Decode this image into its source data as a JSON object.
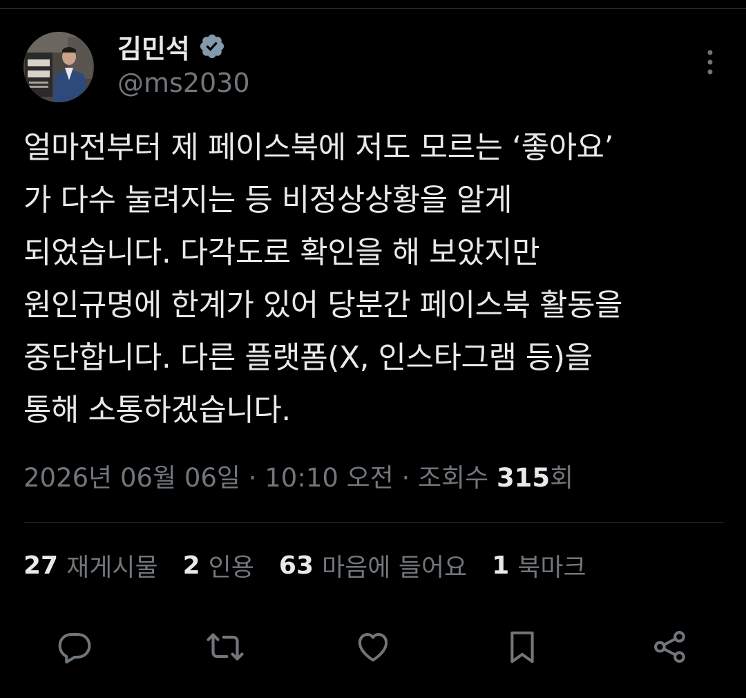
{
  "author": {
    "display_name": "김민석",
    "handle": "@ms2030",
    "avatar_icon": "profile-photo",
    "verified_icon": "verified-badge-icon",
    "verified_color": "#829aab"
  },
  "tweet": {
    "text": "얼마전부터 제 페이스북에 저도 모르는 ‘좋아요’\n가 다수 눌려지는 등 비정상상황을 알게\n되었습니다. 다각도로 확인을 해 보았지만\n원인규명에 한계가 있어 당분간 페이스북 활동을\n중단합니다. 다른 플랫폼(X, 인스타그램 등)을\n통해 소통하겠습니다."
  },
  "meta": {
    "date": "2026년 06월 06일",
    "separator": " · ",
    "time": "10:10 오전",
    "views_label": "조회수 ",
    "views_count": "315",
    "views_suffix": "회"
  },
  "stats": [
    {
      "count": "27",
      "label": "재게시물"
    },
    {
      "count": "2",
      "label": "인용"
    },
    {
      "count": "63",
      "label": "마음에 들어요"
    },
    {
      "count": "1",
      "label": "북마크"
    }
  ],
  "actions": {
    "reply_icon": "reply-icon",
    "repost_icon": "repost-icon",
    "like_icon": "heart-icon",
    "bookmark_icon": "bookmark-icon",
    "share_icon": "share-icon",
    "icon_color": "#71767b"
  },
  "colors": {
    "background": "#000000",
    "text_primary": "#e7e9ea",
    "text_secondary": "#71767b",
    "divider": "#2f3336"
  }
}
